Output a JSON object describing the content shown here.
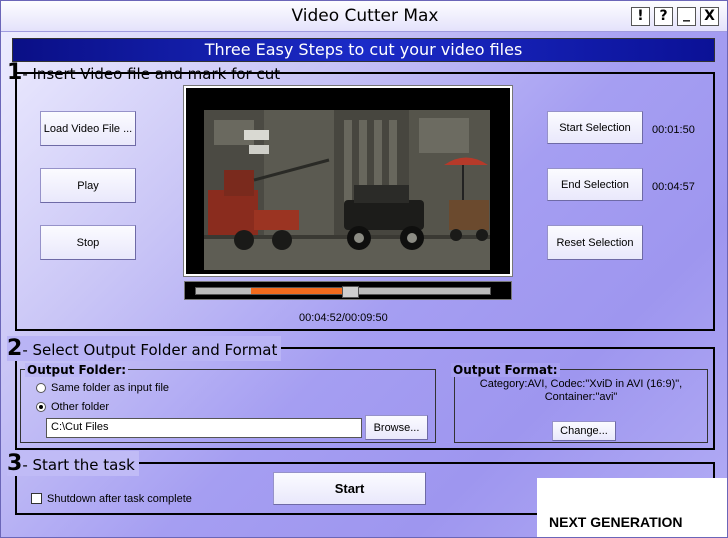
{
  "window": {
    "title": "Video Cutter Max",
    "help_label": "!",
    "question_label": "?",
    "minimize_label": "_",
    "close_label": "X"
  },
  "banner": {
    "text": "Three Easy Steps to cut your video files"
  },
  "step1": {
    "number": "1",
    "title": "- Insert Video file and mark for cut",
    "load_button": "Load Video File ...",
    "play_button": "Play",
    "stop_button": "Stop",
    "start_selection_button": "Start Selection",
    "end_selection_button": "End Selection",
    "reset_selection_button": "Reset Selection",
    "start_time": "00:01:50",
    "end_time": "00:04:57",
    "position_readout": "00:04:52/00:09:50",
    "selection_start_fraction": 0.186,
    "selection_end_fraction": 0.503,
    "playhead_fraction": 0.495
  },
  "step2": {
    "number": "2",
    "title": "- Select Output Folder and Format",
    "output_folder_title": "Output Folder:",
    "same_folder_label": "Same folder as input file",
    "other_folder_label": "Other folder",
    "folder_value": "C:\\Cut Files",
    "browse_button": "Browse...",
    "output_format_title": "Output Format:",
    "format_line1": "Category:AVI, Codec:\"XviD in AVI (16:9)\",",
    "format_line2": "Container:\"avi\"",
    "change_button": "Change..."
  },
  "step3": {
    "number": "3",
    "title": "- Start the task",
    "shutdown_label": "Shutdown after task complete",
    "start_button": "Start"
  },
  "watermark": {
    "text": "NEXT GENERATION"
  },
  "colors": {
    "banner": "#1422b5",
    "selection": "#f26a1c"
  }
}
